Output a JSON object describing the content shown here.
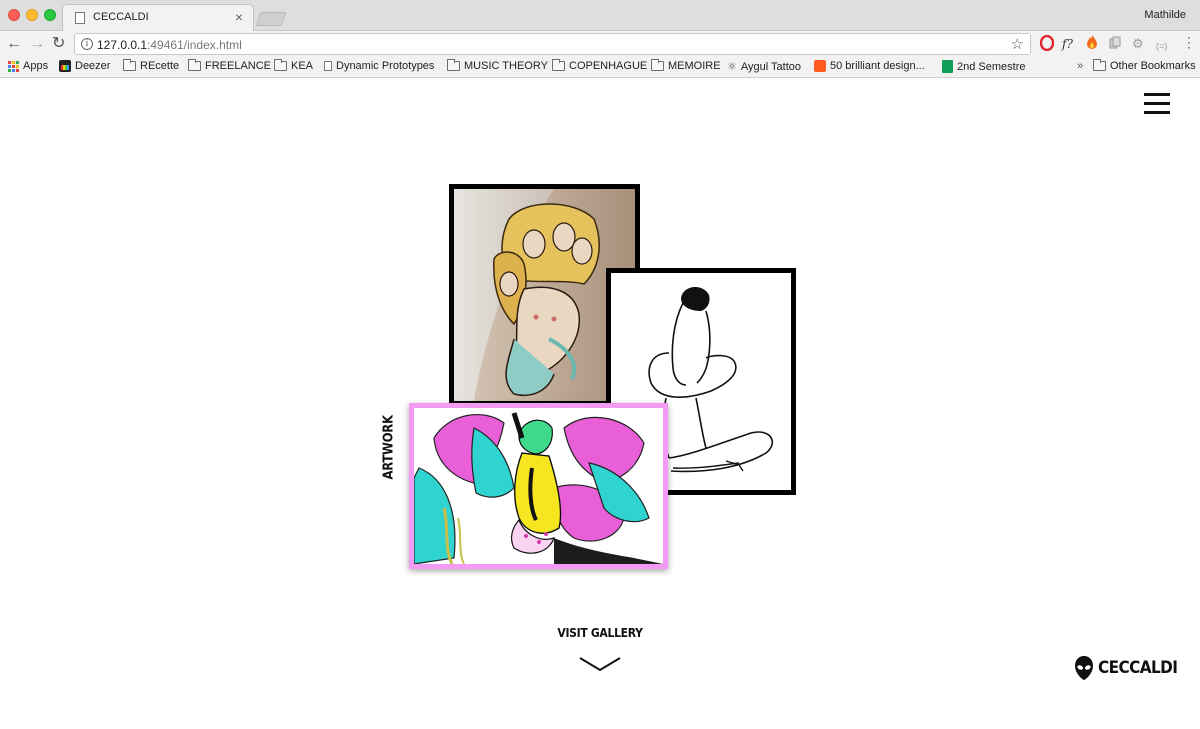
{
  "browser": {
    "tab_title": "CECCALDI",
    "tab_close": "×",
    "profile_name": "Mathilde",
    "url_host": "127.0.0.1",
    "url_rest": ":49461/index.html",
    "info_icon_glyph": "i",
    "extensions": [
      "opera-icon",
      "f?",
      "fire-icon",
      "copy-icon",
      "gear-icon",
      "(=)",
      "more-icon"
    ],
    "bookmarks": [
      {
        "label": "Apps",
        "icon": "apps-icon"
      },
      {
        "label": "Deezer",
        "icon": "deezer-icon"
      },
      {
        "label": "REcette",
        "icon": "folder-icon"
      },
      {
        "label": "FREELANCE",
        "icon": "folder-icon"
      },
      {
        "label": "KEA",
        "icon": "folder-icon"
      },
      {
        "label": "Dynamic Prototypes",
        "icon": "page-icon"
      },
      {
        "label": "MUSIC THEORY",
        "icon": "folder-icon"
      },
      {
        "label": "COPENHAGUE",
        "icon": "folder-icon"
      },
      {
        "label": "MEMOIRE",
        "icon": "folder-icon"
      },
      {
        "label": "Aygul Tattoo",
        "icon": "aygul-icon"
      },
      {
        "label": "50 brilliant design...",
        "icon": "orange-icon"
      },
      {
        "label": "2nd Semestre",
        "icon": "sheets-icon"
      }
    ],
    "bookmarks_overflow": "»",
    "other_bookmarks": "Other Bookmarks"
  },
  "page": {
    "menu_icon": "hamburger-menu-icon",
    "section_label": "ARTWORK",
    "gallery_link": "VISIT GALLERY",
    "gallery_arrow_icon": "chevron-down-icon",
    "logo_text": "CECCALDI",
    "logo_icon": "alien-head-icon",
    "frame_colors": {
      "tattoo": "#000000",
      "line_drawing": "#000000",
      "color_illustration": "#f39bf2"
    },
    "artworks": [
      {
        "name": "tattoo-photo",
        "subject": "tattoo of mermaid-haired women on leg"
      },
      {
        "name": "line-drawing",
        "subject": "black line drawing of seated figure"
      },
      {
        "name": "color-illustration",
        "subject": "neon pink, yellow and cyan illustration"
      }
    ]
  }
}
